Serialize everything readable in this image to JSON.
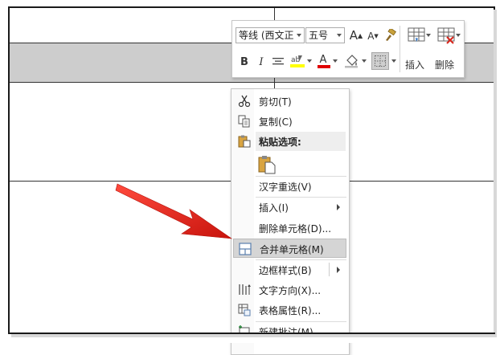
{
  "mini_toolbar": {
    "font_name": "等线 (西文正",
    "font_size": "五号",
    "grow_font_label": "A",
    "shrink_font_label": "A",
    "bold_label": "B",
    "italic_label": "I",
    "font_color_label": "A",
    "insert_label": "插入",
    "delete_label": "删除"
  },
  "context_menu": {
    "items": [
      {
        "label": "剪切(T)",
        "icon": "scissors-icon"
      },
      {
        "label": "复制(C)",
        "icon": "copy-icon"
      },
      {
        "label": "粘贴选项:",
        "icon": "paste-icon"
      },
      {
        "label": "汉字重选(V)",
        "icon": ""
      },
      {
        "label": "插入(I)",
        "icon": "",
        "submenu": true
      },
      {
        "label": "删除单元格(D)...",
        "icon": ""
      },
      {
        "label": "合并单元格(M)",
        "icon": "merge-cells-icon",
        "highlighted": true
      },
      {
        "label": "边框样式(B)",
        "icon": "",
        "submenu": true
      },
      {
        "label": "文字方向(X)...",
        "icon": "text-direction-icon"
      },
      {
        "label": "表格属性(R)...",
        "icon": "table-properties-icon"
      },
      {
        "label": "新建批注(M)",
        "icon": "new-comment-icon"
      }
    ]
  },
  "colors": {
    "selection_gray": "#cdcdcd",
    "highlight_yellow": "#ffff00",
    "font_red": "#e00000",
    "arrow_red": "#e8231c"
  }
}
